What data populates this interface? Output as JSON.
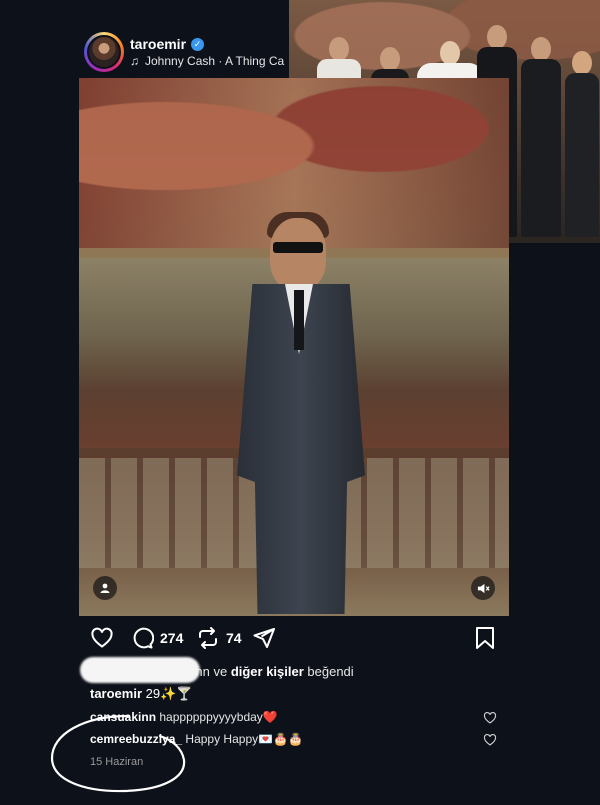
{
  "header": {
    "username": "taroemir",
    "music": "Johnny Cash · A Thing Ca"
  },
  "post": {
    "comment_count": "274",
    "share_count": "74",
    "liked_by": "kinn ve ",
    "liked_by_rest": "diğer kişiler",
    "liked_by_suffix": " beğendi",
    "caption_user": "taroemir",
    "caption_text": "29✨🍸",
    "comments": [
      {
        "user": "cansuakinn",
        "text": "happppppyyyybday❤️"
      },
      {
        "user": "cemreebuzziya_",
        "text": "Happy Happy💌🎂🎂"
      }
    ],
    "date": "15 Haziran"
  },
  "icons": {
    "verified": "verified-badge-icon",
    "music": "music-note-icon",
    "like": "heart-icon",
    "comment": "comment-icon",
    "repost": "repost-icon",
    "share": "send-icon",
    "save": "bookmark-icon",
    "tag": "person-tag-icon",
    "mute": "speaker-muted-icon"
  },
  "colors": {
    "background": "#0d111a",
    "verified": "#3897f0",
    "text_muted": "#9a9a9a"
  }
}
